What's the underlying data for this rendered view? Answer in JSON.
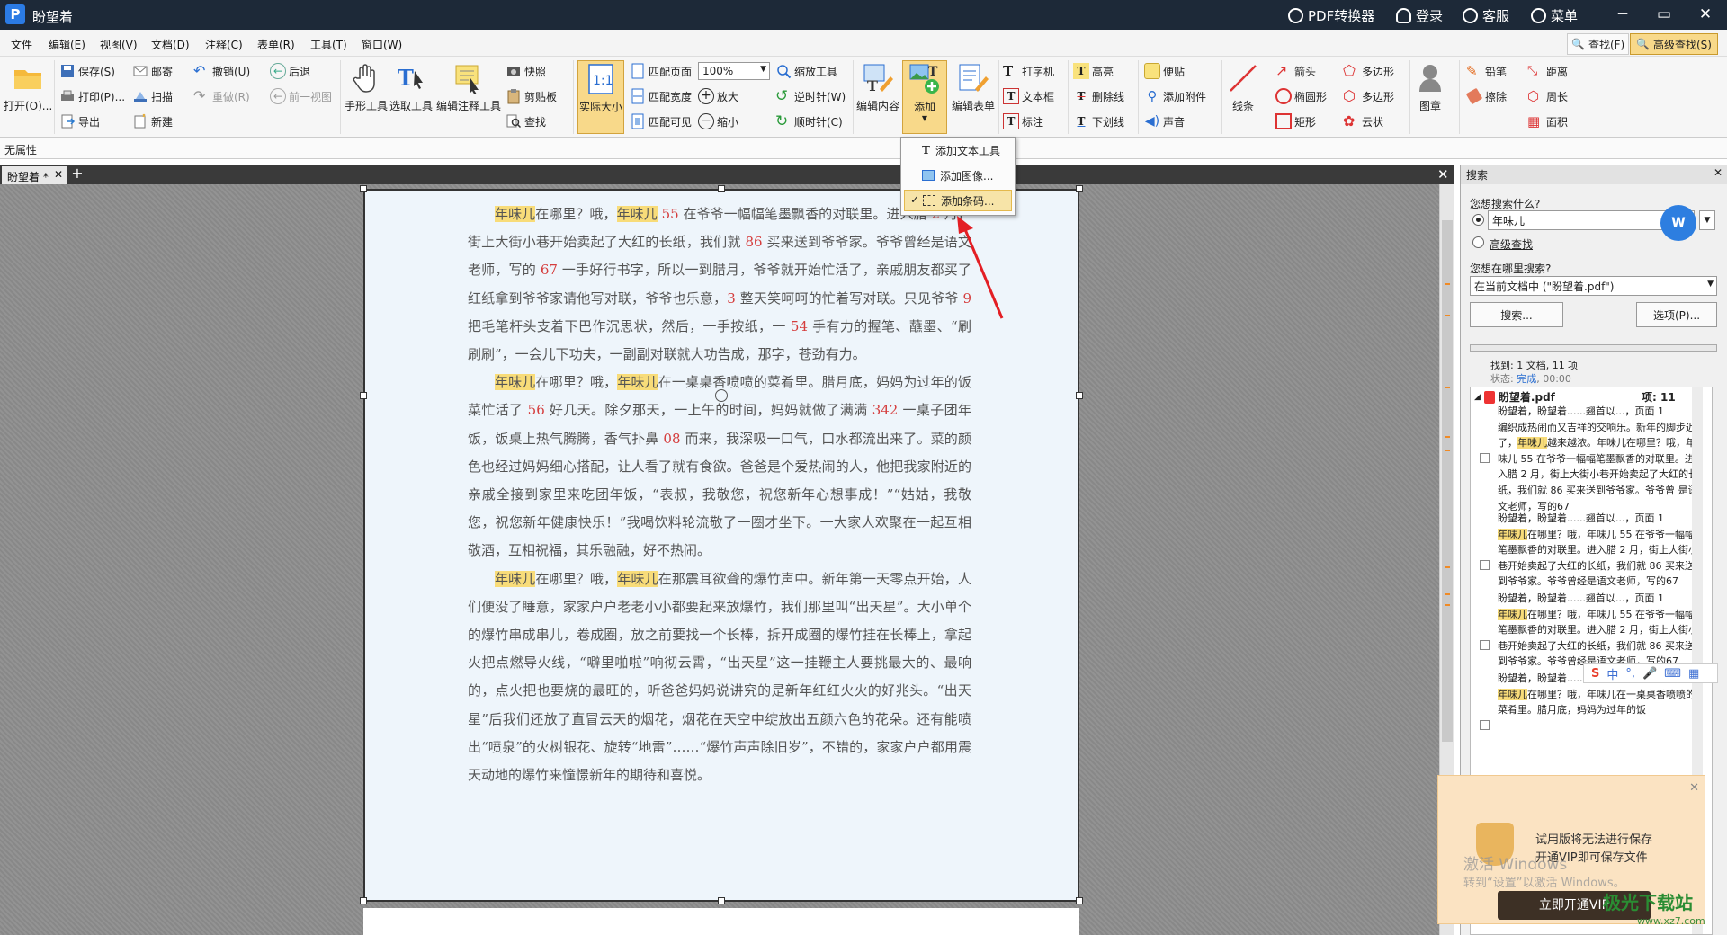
{
  "app": {
    "logo": "P",
    "title": "盼望着"
  },
  "titlebar": {
    "pdf_converter": "PDF转换器",
    "login": "登录",
    "service": "客服",
    "menu": "菜单",
    "minimize": "─",
    "restore": "▭",
    "close": "✕"
  },
  "menubar": {
    "items": [
      "文件",
      "编辑(E)",
      "视图(V)",
      "文档(D)",
      "注释(C)",
      "表单(R)",
      "工具(T)",
      "窗口(W)"
    ],
    "find": "查找(F)",
    "advanced_find": "高级查找(S)"
  },
  "ribbon": {
    "open": "打开(O)...",
    "save": "保存(S)",
    "print": "打印(P)...",
    "export": "导出",
    "mail": "邮寄",
    "scan": "扫描",
    "new": "新建",
    "undo": "撤销(U)",
    "redo": "重做(R)",
    "back": "后退",
    "prev_view": "前一视图",
    "hand_tool": "手形工具",
    "select_tool": "选取工具",
    "edit_annot_tool": "编辑注释工具",
    "snapshot": "快照",
    "clipboard": "剪贴板",
    "find": "查找",
    "actual_size": "实际大小",
    "fit_page": "匹配页面",
    "fit_width": "匹配宽度",
    "fit_visible": "匹配可见",
    "zoom_value": "100%",
    "zoom_in": "放大",
    "zoom_out": "缩小",
    "zoom_tool": "缩放工具",
    "rotate_ccw": "逆时针(W)",
    "rotate_cw": "顺时针(C)",
    "edit_content": "编辑内容",
    "add": "添加",
    "edit_form": "编辑表单",
    "typewriter": "打字机",
    "textbox": "文本框",
    "callout": "标注",
    "highlight": "高亮",
    "strikeout": "删除线",
    "underline": "下划线",
    "note": "便贴",
    "attach": "添加附件",
    "sound": "声音",
    "line": "线条",
    "arrow": "箭头",
    "ellipse": "椭圆形",
    "rect": "矩形",
    "polygon": "多边形",
    "polyline": "多边形",
    "cloud": "云状",
    "stamp": "图章",
    "pencil": "铅笔",
    "eraser": "擦除",
    "distance": "距离",
    "perimeter": "周长",
    "area": "面积"
  },
  "propbar": {
    "label": "无属性"
  },
  "doc_tab": {
    "label": "盼望着 *",
    "close": "✕",
    "new": "+"
  },
  "dropdown": {
    "items": [
      "添加文本工具",
      "添加图像...",
      "添加条码..."
    ],
    "checked_index": 2
  },
  "document": {
    "paragraphs": [
      [
        [
          "hl",
          "年味儿"
        ],
        [
          "t",
          "在哪里？哦，"
        ],
        [
          "hl",
          "年味儿"
        ],
        [
          "n",
          " 55 "
        ],
        [
          "t",
          "在爷爷一幅幅笔墨飘香的对联里。进入腊"
        ],
        [
          "n",
          " 2 "
        ],
        [
          "t",
          "月，街上大街小巷开始卖起了大红的长纸，我们就"
        ],
        [
          "n",
          " 86 "
        ],
        [
          "t",
          "买来送到爷爷家。爷爷曾经是语文老师，写的"
        ],
        [
          "n",
          " 67 "
        ],
        [
          "t",
          "一手好行书字，所以一到腊月，爷爷就开始忙活了，亲戚朋友都买了红纸拿到爷爷家请他写对联，爷爷也乐意，"
        ],
        [
          "n",
          "3"
        ],
        [
          "t",
          " 整天笑呵呵的忙着写对联。只见爷爷"
        ],
        [
          "n",
          " 9 "
        ],
        [
          "t",
          "把毛笔杆头支着下巴作沉思状，然后，一手按纸，一"
        ],
        [
          "n",
          " 54 "
        ],
        [
          "t",
          "手有力的握笔、蘸墨、“刷刷刷”，一会儿下功夫，一副副对联就大功告成，那字，苍劲有力。"
        ]
      ],
      [
        [
          "hl",
          "年味儿"
        ],
        [
          "t",
          "在哪里？哦，"
        ],
        [
          "hl",
          "年味儿"
        ],
        [
          "t",
          "在一桌桌香喷喷的菜肴里。腊月底，妈妈为过年的饭菜忙活了"
        ],
        [
          "n",
          " 56 "
        ],
        [
          "t",
          "好几天。除夕那天，一上午的时间，妈妈就做了满满"
        ],
        [
          "n",
          " 342 "
        ],
        [
          "t",
          "一桌子团年饭，饭桌上热气腾腾，香气扑鼻"
        ],
        [
          "n",
          " 08 "
        ],
        [
          "t",
          "而来，我深吸一口气，口水都流出来了。菜的颜色也经过妈妈细心搭配，让人看了就有食欲。爸爸是个爱热闹的人，他把我家附近的亲戚全接到家里来吃团年饭，“表叔，我敬您，祝您新年心想事成！”“姑姑，我敬您，祝您新年健康快乐！”我喝饮料轮流敬了一圈才坐下。一大家人欢聚在一起互相敬酒，互相祝福，其乐融融，好不热闹。"
        ]
      ],
      [
        [
          "hl",
          "年味儿"
        ],
        [
          "t",
          "在哪里？哦，"
        ],
        [
          "hl",
          "年味儿"
        ],
        [
          "t",
          "在那震耳欲聋的爆竹声中。新年第一天零点开始，人们便没了睡意，家家户户老老小小都要起来放爆竹，我们那里叫“出天星”。大小单个的爆竹串成串儿，卷成圈，放之前要找一个长棒，拆开成圈的爆竹挂在长棒上，拿起火把点燃导火线，“噼里啪啦”响彻云霄，“出天星”这一挂鞭主人要挑最大的、最响的，点火把也要烧的最旺的，听爸爸妈妈说讲究的是新年红红火火的好兆头。“出天星”后我们还放了直冒云天的烟花，烟花在天空中绽放出五颜六色的花朵。还有能喷出“喷泉”的火树银花、旋转“地雷”……“爆竹声声除旧岁”，不错的，家家户户都用震天动地的爆竹来憧憬新年的期待和喜悦。"
        ]
      ]
    ]
  },
  "search_panel": {
    "title": "搜索",
    "close": "✕",
    "q_label": "您想搜索什么?",
    "query": "年味儿",
    "advanced": "高级查找",
    "where_label": "您想在哪里搜索?",
    "where_value": "在当前文档中 (\"盼望着.pdf\")",
    "search_btn": "搜索...",
    "options_btn": "选项(P)...",
    "found": "找到: 1 文档, 11 项",
    "status_label": "状态: ",
    "status_value": "完成",
    "status_time": ", 00:00",
    "file": "盼望着.pdf",
    "count_label": "项: 11",
    "results": [
      [
        "盼望着，盼望着......翘首以...，页面 1",
        "编织成热闹而又吉祥的交响乐。新年的脚步近了，",
        "年味儿",
        "越来越浓。年味儿在哪里？哦，年味儿 55 在爷爷一幅幅笔墨飘香的对联里。进入腊 2 月，街上大街小巷开始卖起了大红的长纸，我们就 86 买来送到爷爷家。爷爷曾 是语文老师，写的67"
      ],
      [
        "盼望着，盼望着......翘首以...，页面 1",
        "",
        "年味儿",
        "在哪里？哦，年味儿 55 在爷爷一幅幅笔墨飘香的对联里。进入腊 2 月，街上大街小巷开始卖起了大红的长纸，我们就 86 买来送到爷爷家。爷爷曾经是语文老师，写的67"
      ],
      [
        "盼望着，盼望着......翘首以...，页面 1",
        "",
        "年味儿",
        "在哪里？哦，年味儿 55 在爷爷一幅幅笔墨飘香的对联里。进入腊 2 月，街上大街小巷开始卖起了大红的长纸，我们就 86 买来送到爷爷家。爷爷曾经是语文老师，写的67"
      ],
      [
        "盼望着，盼望着......翘首以...，页面 1",
        "",
        "年味儿",
        "在哪里？哦，年味儿在一桌桌香喷喷的菜肴里。腊月底，妈妈为过年的饭"
      ]
    ]
  },
  "vip_popup": {
    "line1": "试用版将无法进行保存",
    "line2": "开通VIP即可保存文件",
    "button": "立即开通VIP",
    "close": "✕"
  },
  "os_watermark": {
    "line1": "激活 Windows",
    "line2": "转到“设置”以激活 Windows。"
  },
  "ime_bar": {
    "lang": "中"
  },
  "site_watermark": {
    "name": "极光下载站",
    "url": "www.xz7.com"
  }
}
